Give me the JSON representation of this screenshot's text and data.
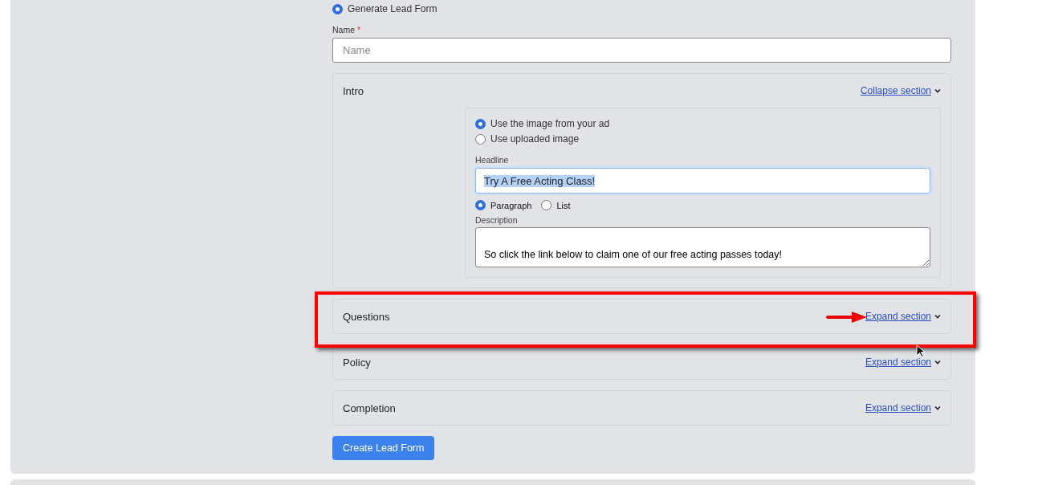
{
  "form_type": {
    "label": "Generate Lead Form",
    "selected": true
  },
  "name_field": {
    "label": "Name",
    "required_mark": "*",
    "placeholder": "Name"
  },
  "sections": [
    {
      "title": "Intro",
      "link": "Collapse section",
      "expanded": true
    },
    {
      "title": "Questions",
      "link": "Expand section",
      "expanded": false
    },
    {
      "title": "Policy",
      "link": "Expand section",
      "expanded": false
    },
    {
      "title": "Completion",
      "link": "Expand section",
      "expanded": false
    }
  ],
  "intro": {
    "image_options": [
      {
        "label": "Use the image from your ad",
        "selected": true
      },
      {
        "label": "Use uploaded image",
        "selected": false
      }
    ],
    "headline": {
      "label": "Headline",
      "value": "Try A Free Acting Class!",
      "text_selected": true
    },
    "description_formats": [
      {
        "label": "Paragraph",
        "selected": true
      },
      {
        "label": "List",
        "selected": false
      }
    ],
    "description": {
      "label": "Description",
      "value": "So click the link below to claim one of our free acting passes today!"
    }
  },
  "submit_button": "Create Lead Form"
}
